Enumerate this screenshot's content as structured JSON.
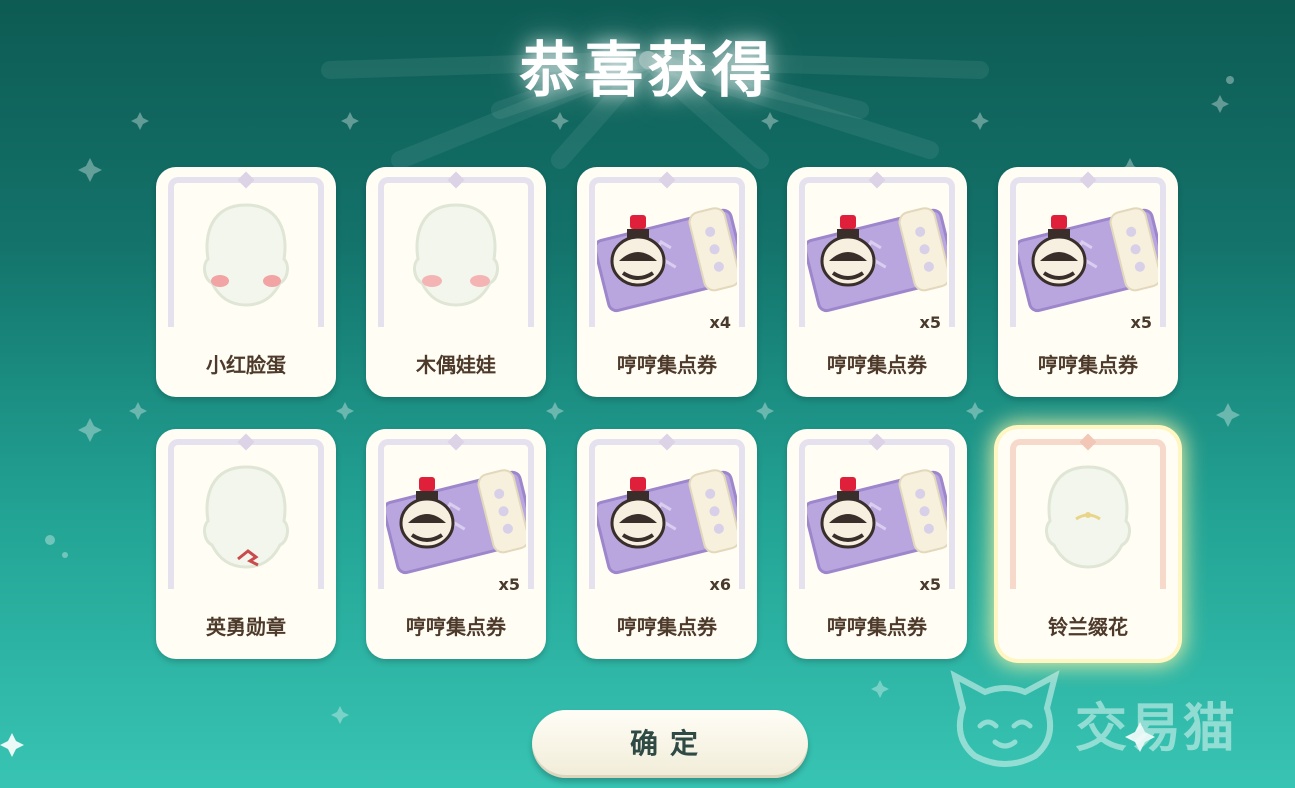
{
  "title": "恭喜获得",
  "items": [
    {
      "name": "小红脸蛋",
      "qty": "",
      "type": "blush"
    },
    {
      "name": "木偶娃娃",
      "qty": "",
      "type": "doll"
    },
    {
      "name": "哼哼集点券",
      "qty": "x4",
      "type": "ticket"
    },
    {
      "name": "哼哼集点券",
      "qty": "x5",
      "type": "ticket"
    },
    {
      "name": "哼哼集点券",
      "qty": "x5",
      "type": "ticket"
    },
    {
      "name": "英勇勋章",
      "qty": "",
      "type": "medal"
    },
    {
      "name": "哼哼集点券",
      "qty": "x5",
      "type": "ticket"
    },
    {
      "name": "哼哼集点券",
      "qty": "x6",
      "type": "ticket"
    },
    {
      "name": "哼哼集点券",
      "qty": "x5",
      "type": "ticket"
    },
    {
      "name": "铃兰缀花",
      "qty": "",
      "type": "flower",
      "highlight": true
    }
  ],
  "confirm_label": "确定",
  "watermark": {
    "text": "交易猫",
    "icon": "cat-logo-icon"
  },
  "colors": {
    "bg_top": "#0d5b53",
    "bg_bottom": "#38c4b3",
    "card": "#fffdf4",
    "text": "#4e3a2b"
  }
}
